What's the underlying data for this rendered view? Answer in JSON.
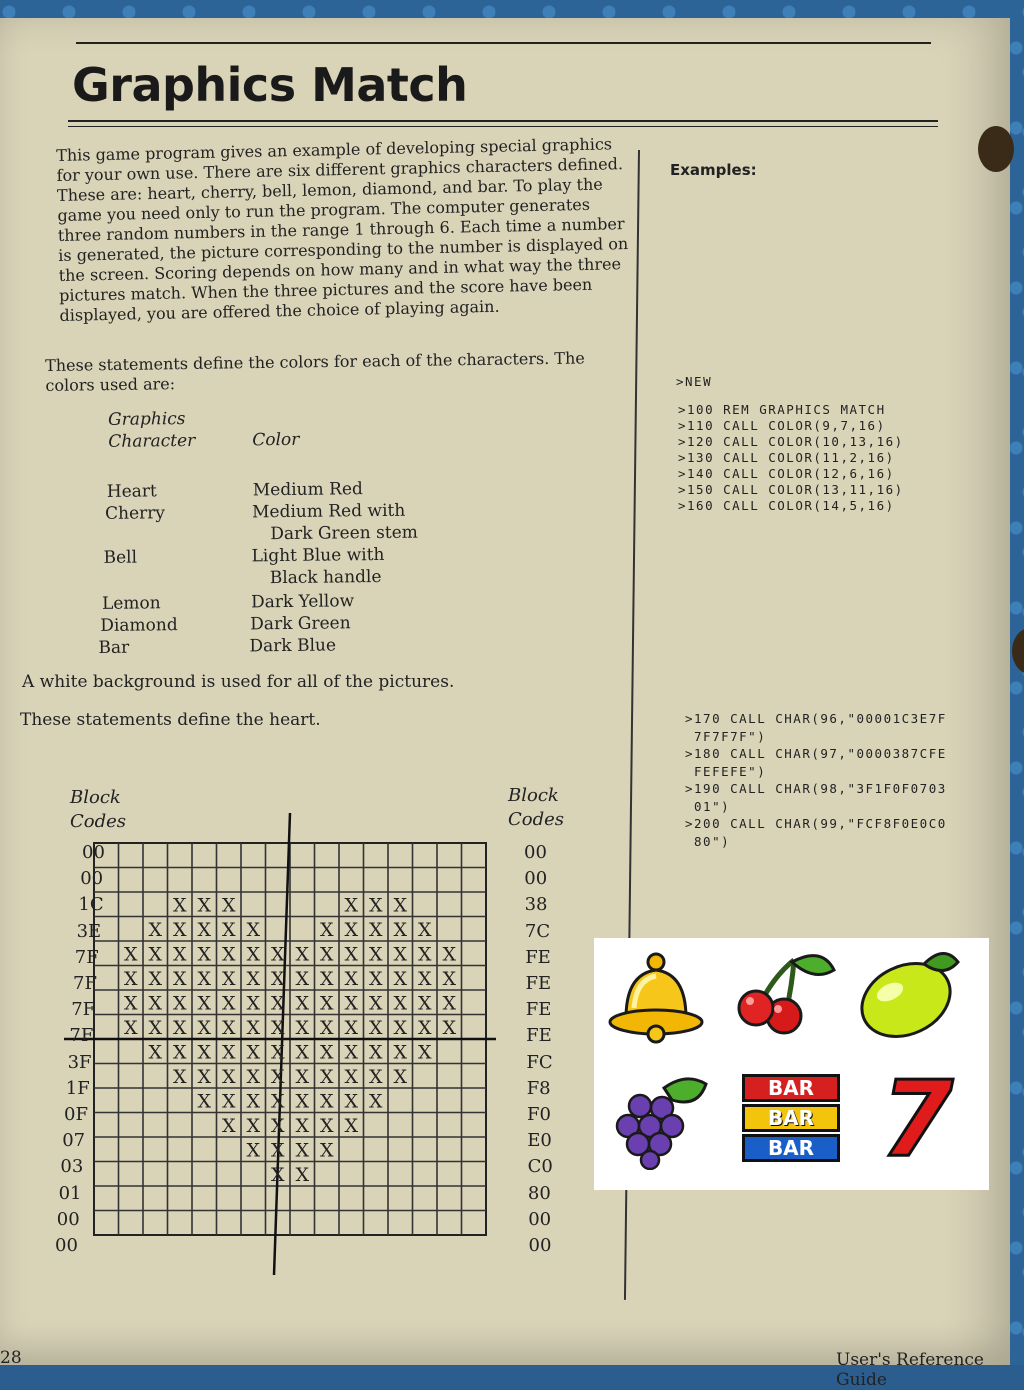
{
  "page": {
    "title": "Graphics Match",
    "intro": "This game program gives an example of developing special graphics for your own use. There are six different graphics characters defined. These are: heart, cherry, bell, lemon, diamond, and bar. To play the game you need only to run the program. The computer generates three random numbers in the range 1 through 6. Each time a number is generated, the picture corresponding to the number is displayed on the screen. Scoring depends on how many and in what way the three pictures match. When the three pictures and the score have been displayed, you are offered the choice of playing again.",
    "colors_intro": "These statements define the colors for each of the characters. The colors used are:",
    "table_header_char_1": "Graphics",
    "table_header_char_2": "Character",
    "table_header_color": "Color",
    "color_rows": [
      {
        "char": "Heart",
        "color": "Medium Red",
        "color2": ""
      },
      {
        "char": "Cherry",
        "color": "Medium Red with",
        "color2": "Dark Green stem"
      },
      {
        "char": "Bell",
        "color": "Light Blue with",
        "color2": "Black handle"
      },
      {
        "char": "Lemon",
        "color": "Dark Yellow",
        "color2": ""
      },
      {
        "char": "Diamond",
        "color": "Dark Green",
        "color2": ""
      },
      {
        "char": "Bar",
        "color": "Dark Blue",
        "color2": ""
      }
    ],
    "white_note": "A white background is used for all of the pictures.",
    "heart_note": "These statements define the heart.",
    "footer_page": "28",
    "footer_title": "User's Reference Guide"
  },
  "examples": {
    "heading": "Examples:",
    "new_cmd": ">NEW",
    "color_code": [
      ">100 REM GRAPHICS MATCH",
      ">110 CALL COLOR(9,7,16)",
      ">120 CALL COLOR(10,13,16)",
      ">130 CALL COLOR(11,2,16)",
      ">140 CALL COLOR(12,6,16)",
      ">150 CALL COLOR(13,11,16)",
      ">160 CALL COLOR(14,5,16)"
    ],
    "char_code": [
      ">170 CALL CHAR(96,\"00001C3E7F",
      " 7F7F7F\")",
      ">180 CALL CHAR(97,\"0000387CFE",
      " FEFEFE\")",
      ">190 CALL CHAR(98,\"3F1F0F0703",
      " 01\")",
      ">200 CALL CHAR(99,\"FCF8F0E0C0",
      " 80\")"
    ]
  },
  "grid": {
    "label_line1": "Block",
    "label_line2": "Codes",
    "left_codes": [
      "00",
      "00",
      "1C",
      "3E",
      "7F",
      "7F",
      "7F",
      "7F",
      "3F",
      "1F",
      "0F",
      "07",
      "03",
      "01",
      "00",
      "00"
    ],
    "right_codes": [
      "00",
      "00",
      "38",
      "7C",
      "FE",
      "FE",
      "FE",
      "FE",
      "FC",
      "F8",
      "F0",
      "E0",
      "C0",
      "80",
      "00",
      "00"
    ],
    "mark": "X"
  },
  "overlay_icons": [
    "bell-icon",
    "cherry-icon",
    "lemon-icon",
    "grapes-icon",
    "bar-icon",
    "seven-icon"
  ],
  "overlay_bar_text": "BAR",
  "overlay_seven_text": "7"
}
